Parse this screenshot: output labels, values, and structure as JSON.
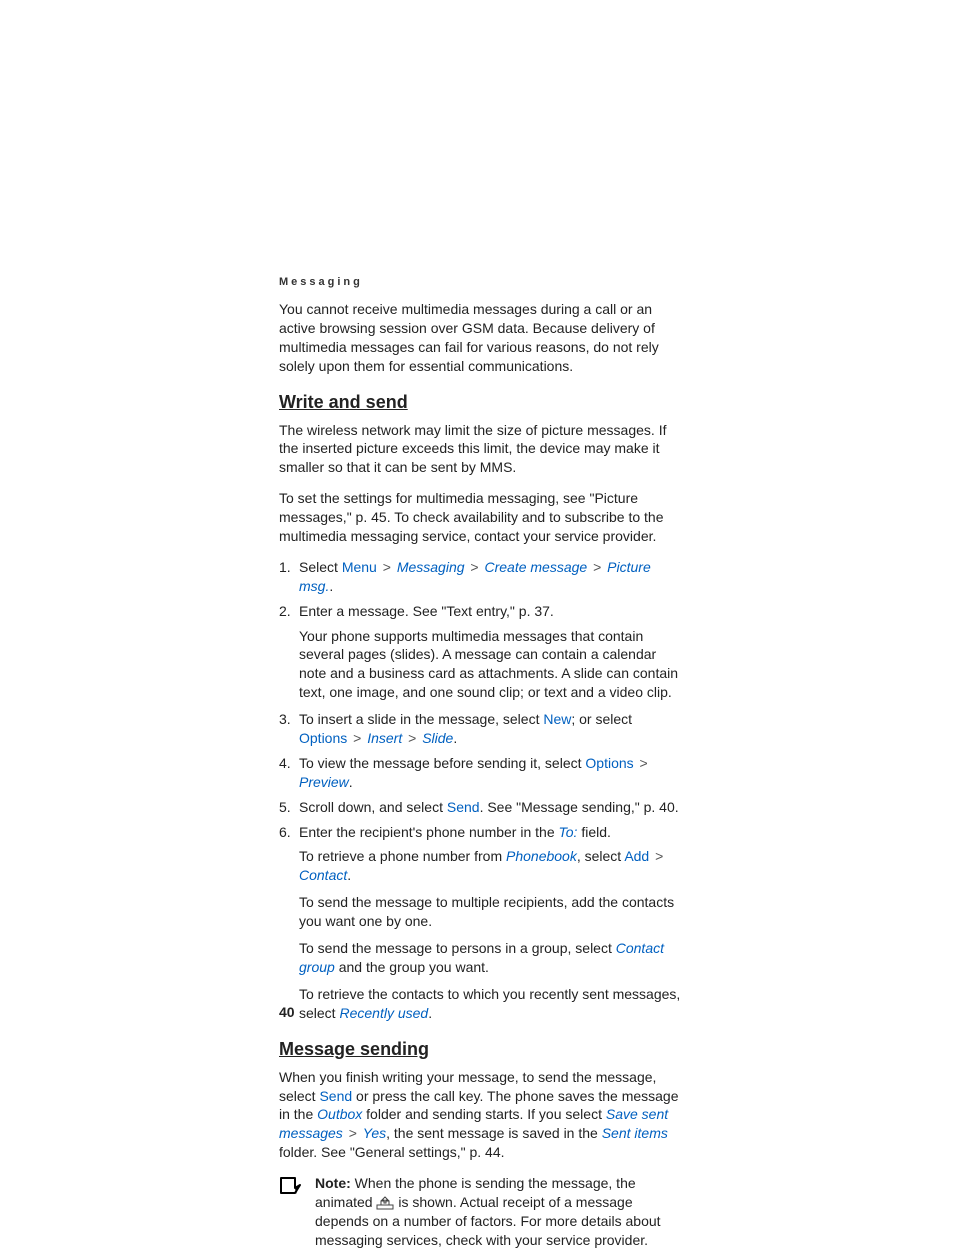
{
  "header": "Messaging",
  "intro": "You cannot receive multimedia messages during a call or an active browsing session over GSM data. Because delivery of multimedia messages can fail for various reasons, do not rely solely upon them for essential communications.",
  "s1": {
    "title": "Write and send",
    "p1": "The wireless network may limit the size of picture messages. If the inserted picture exceeds this limit, the device may make it smaller so that it can be sent by MMS.",
    "p2": "To set the settings for multimedia messaging, see \"Picture messages,\" p. 45. To check availability and to subscribe to the multimedia messaging service, contact your service provider.",
    "li1": {
      "n": "1.",
      "pre": "Select ",
      "menu": "Menu",
      "messaging": "Messaging",
      "create_message": "Create message",
      "picture_msg": "Picture msg.",
      "dot": "."
    },
    "li2": {
      "n": "2.",
      "main": "Enter a message. See \"Text entry,\" p. 37.",
      "sub": "Your phone supports multimedia messages that contain several pages (slides). A message can contain a calendar note and a business card as attachments. A slide can contain text, one image, and one sound clip; or text and a video clip."
    },
    "li3": {
      "n": "3.",
      "t1": "To insert a slide in the message, select ",
      "new": "New",
      "t2": "; or select ",
      "options": "Options",
      "insert": "Insert",
      "slide": "Slide",
      "dot": "."
    },
    "li4": {
      "n": "4.",
      "t1": "To view the message before sending it, select ",
      "options": "Options",
      "preview": "Preview",
      "dot": "."
    },
    "li5": {
      "n": "5.",
      "t1": "Scroll down, and select ",
      "send": "Send",
      "t2": ". See \"Message sending,\" p. 40."
    },
    "li6": {
      "n": "6.",
      "t1": "Enter the recipient's phone number in the ",
      "to": "To:",
      "t2": " field.",
      "sub1a": "To retrieve a phone number from ",
      "phonebook": "Phonebook",
      "sub1b": ", select ",
      "add": "Add",
      "contact": "Contact",
      "dot": ".",
      "sub2": "To send the message to multiple recipients, add the contacts you want one by one.",
      "sub3a": "To send the message to persons in a group, select ",
      "contact_group": "Contact group",
      "sub3b": " and the group you want.",
      "sub4a": "To retrieve the contacts to which you recently sent messages, select ",
      "recently_used": "Recently used",
      "sub4b": "."
    }
  },
  "s2": {
    "title": "Message sending",
    "p1a": "When you finish writing your message, to send the message, select ",
    "send": "Send",
    "p1b": " or press the call key. The phone saves the message in the ",
    "outbox": "Outbox",
    "p1c": " folder and sending starts. If you select ",
    "save_sent": "Save sent messages",
    "yes": "Yes",
    "p1d": ", the sent message is saved in the ",
    "sent_items": "Sent items",
    "p1e": " folder. See \"General settings,\" p. 44.",
    "note_label": "Note:",
    "note_a": " When the phone is sending the message, the animated ",
    "note_b": " is shown. Actual receipt of a message depends on a number of factors. For more details about messaging services, check with your service provider."
  },
  "page_num": "40",
  "gt": ">"
}
